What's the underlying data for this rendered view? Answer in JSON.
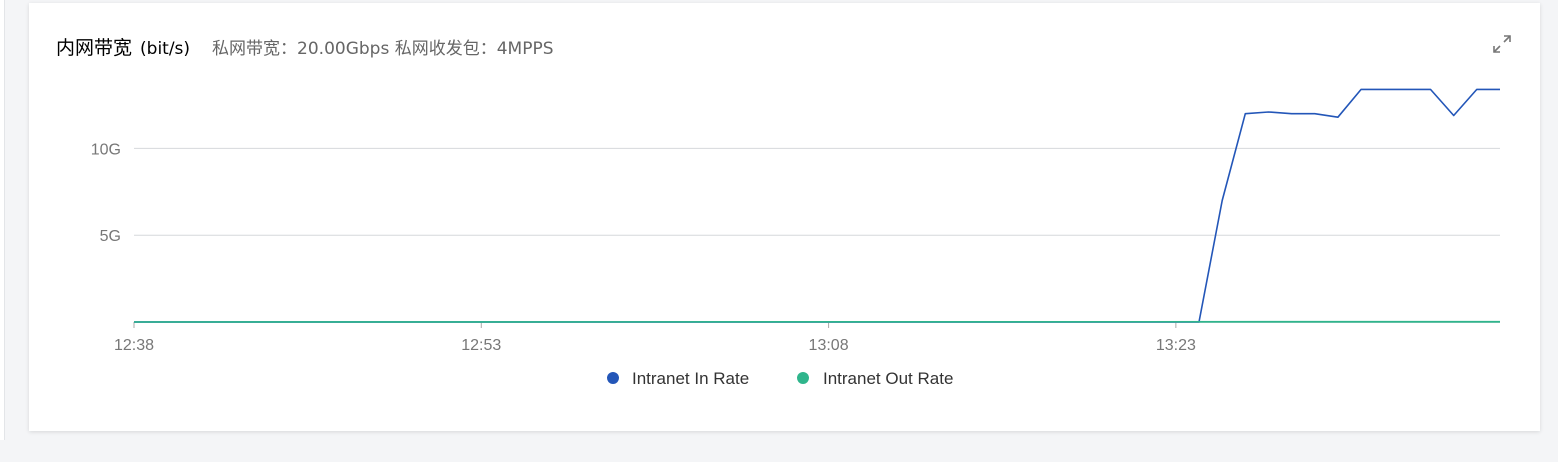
{
  "panel": {
    "title": "内网带宽",
    "unit": "(bit/s)",
    "subtitle": "私网带宽：20.00Gbps 私网收发包：4MPPS",
    "expand_icon": "expand-icon"
  },
  "colors": {
    "in": "#2356b8",
    "out": "#2fb58c",
    "grid": "#d6d8dc",
    "axis": "#2a9a7e"
  },
  "chart_data": {
    "type": "line",
    "title": "内网带宽",
    "xlabel": "",
    "ylabel": "(bit/s)",
    "x_ticks": [
      "12:38",
      "12:53",
      "13:08",
      "13:23"
    ],
    "y_ticks": [
      "5G",
      "10G"
    ],
    "ylim": [
      0,
      14
    ],
    "xlim": [
      0,
      59
    ],
    "x_tick_values": [
      0,
      15,
      30,
      45
    ],
    "grid": true,
    "legend": "bottom",
    "series": [
      {
        "name": "Intranet In Rate",
        "x": [
          0,
          46,
          47,
          48,
          49,
          50,
          51,
          52,
          53,
          54,
          55,
          56,
          57,
          58,
          59
        ],
        "values": [
          0.0,
          0.0,
          7.0,
          12.0,
          12.1,
          12.0,
          12.0,
          11.8,
          13.4,
          13.4,
          13.4,
          13.4,
          11.9,
          13.4,
          13.4
        ]
      },
      {
        "name": "Intranet Out Rate",
        "x": [
          0,
          52,
          59
        ],
        "values": [
          0.0,
          0.02,
          0.02
        ]
      }
    ]
  }
}
